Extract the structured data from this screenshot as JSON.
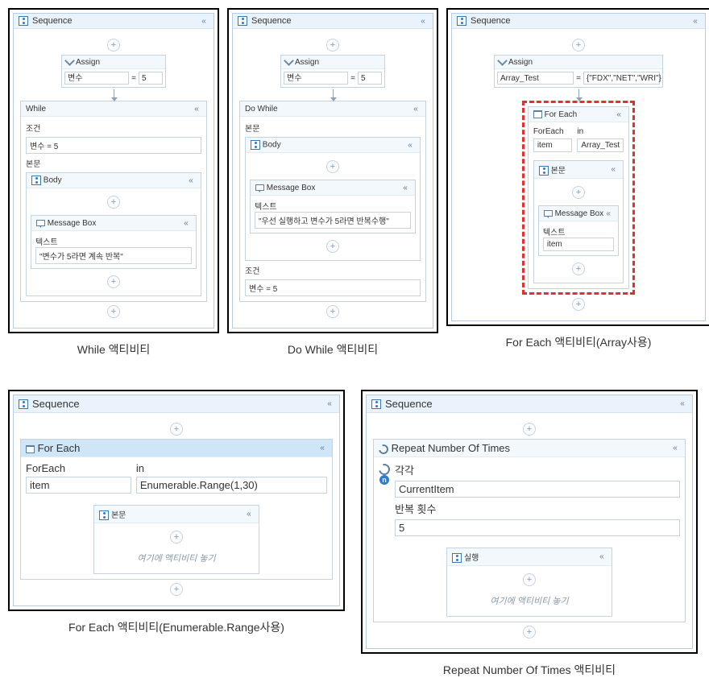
{
  "common": {
    "sequence": "Sequence",
    "assign": "Assign",
    "body_en": "Body",
    "body_ko": "본문",
    "condition": "조건",
    "text_label": "텍스트",
    "message_box": "Message Box",
    "drop_here": "여기에 액티비티 놓기",
    "execute": "실행"
  },
  "while": {
    "title": "While",
    "var": "변수",
    "val": "5",
    "cond": "변수 = 5",
    "msg": "\"변수가 5라면 계속 반복\"",
    "caption": "While 액티비티"
  },
  "dowhile": {
    "title": "Do While",
    "var": "변수",
    "val": "5",
    "cond": "변수 = 5",
    "msg": "\"우선 실행하고 변수가 5라면 반복수행\"",
    "caption": "Do While 액티비티"
  },
  "foreach_arr": {
    "title": "For Each",
    "label_fe": "ForEach",
    "label_in": "in",
    "item": "item",
    "coll": "Array_Test",
    "assign_var": "Array_Test",
    "assign_val": "{\"FDX\",\"NET\",\"WRI\"}",
    "msg": "item",
    "caption": "For Each 액티비티(Array사용)"
  },
  "foreach_enum": {
    "title": "For Each",
    "label_fe": "ForEach",
    "label_in": "in",
    "item": "item",
    "coll": "Enumerable.Range(1,30)",
    "caption": "For Each 액티비티(Enumerable.Range사용)"
  },
  "repeat": {
    "title": "Repeat Number Of Times",
    "each": "각각",
    "current": "CurrentItem",
    "count_label": "반복 횟수",
    "count_val": "5",
    "caption": "Repeat Number Of Times 액티비티"
  }
}
